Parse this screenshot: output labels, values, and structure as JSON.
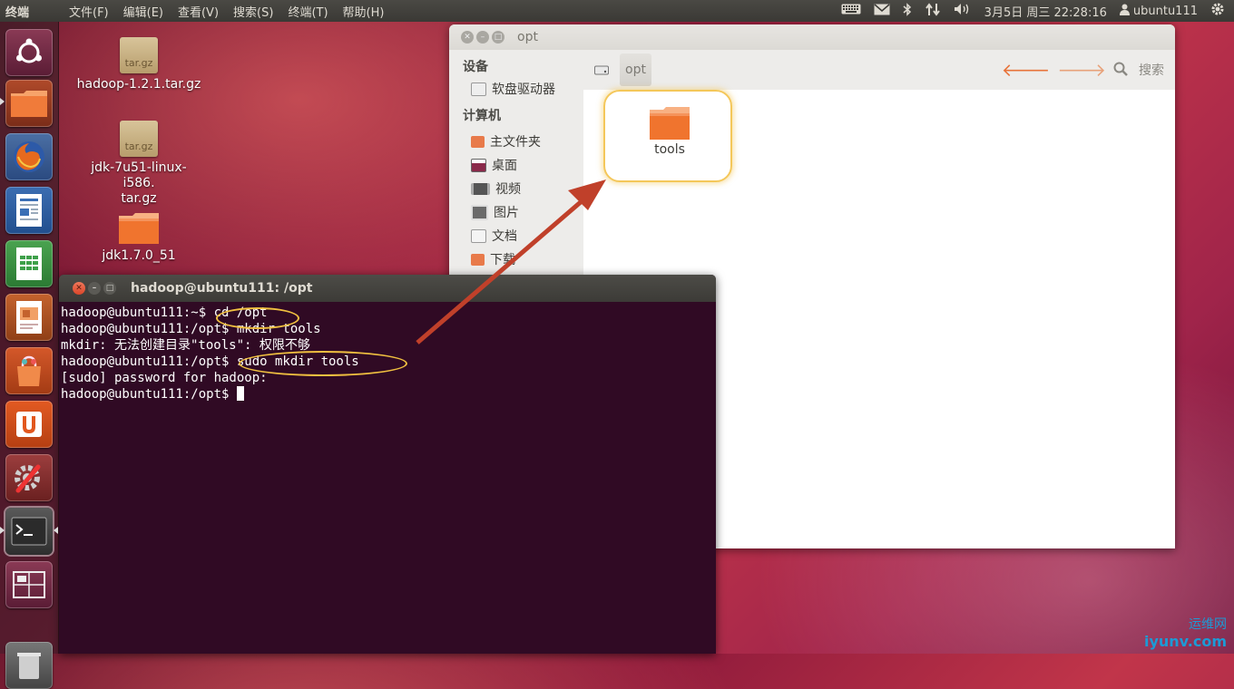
{
  "top_panel": {
    "app_title": "终端",
    "menus": [
      "文件(F)",
      "编辑(E)",
      "查看(V)",
      "搜索(S)",
      "终端(T)",
      "帮助(H)"
    ],
    "clock": "3月5日 周三 22:28:16",
    "user": "ubuntu111",
    "icons": [
      "keyboard-icon",
      "mail-icon",
      "bluetooth-icon",
      "network-icon",
      "volume-icon",
      "user-icon",
      "gear-icon"
    ]
  },
  "launcher": {
    "items": [
      "dash-home-icon",
      "files-icon",
      "firefox-icon",
      "writer-icon",
      "calc-icon",
      "impress-icon",
      "software-center-icon",
      "ubuntu-one-icon",
      "system-settings-icon",
      "terminal-icon",
      "workspace-switcher-icon",
      "trash-icon"
    ]
  },
  "desktop": {
    "icons": [
      {
        "label": "hadoop-1.2.1.tar.gz",
        "badge": "tar.gz"
      },
      {
        "label": "jdk-7u51-linux-i586.\ntar.gz",
        "badge": "tar.gz"
      },
      {
        "label": "jdk1.7.0_51"
      }
    ]
  },
  "file_manager": {
    "title": "opt",
    "sidebar": {
      "sections": [
        {
          "title": "设备",
          "items": [
            "软盘驱动器"
          ]
        },
        {
          "title": "计算机",
          "items": [
            "主文件夹",
            "桌面",
            "视频",
            "图片",
            "文档",
            "下载"
          ]
        }
      ]
    },
    "breadcrumb": "opt",
    "search_label": "搜索",
    "files": [
      {
        "name": "tools"
      }
    ]
  },
  "terminal": {
    "title": "hadoop@ubuntu111: /opt",
    "lines": [
      "hadoop@ubuntu111:~$ cd /opt",
      "hadoop@ubuntu111:/opt$ mkdir tools",
      "mkdir: 无法创建目录\"tools\": 权限不够",
      "hadoop@ubuntu111:/opt$ sudo mkdir tools",
      "[sudo] password for hadoop:",
      "hadoop@ubuntu111:/opt$ "
    ]
  },
  "watermark": {
    "line1": "运维网",
    "line2": "iyunv.com"
  },
  "colors": {
    "accent": "#dd4814",
    "terminal_bg": "#300a24",
    "highlight": "#f0c040",
    "arrow": "#c0402a"
  }
}
